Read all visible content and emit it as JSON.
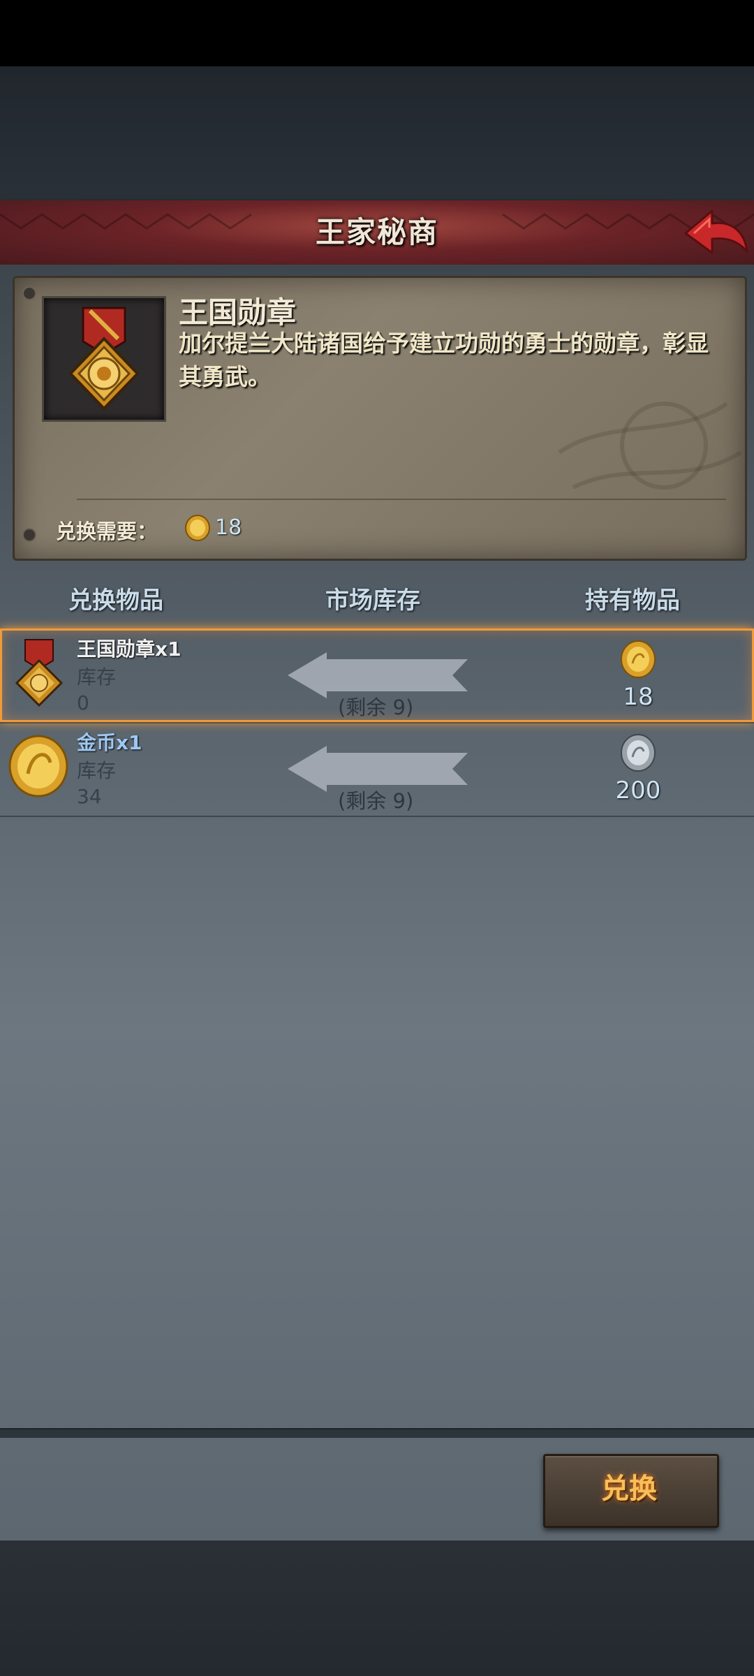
{
  "title": "王家秘商",
  "item": {
    "name": "王国勋章",
    "description": "加尔提兰大陆诸国给予建立功勋的勇士的勋章，彰显其勇武。",
    "cost_label": "兑换需要：",
    "cost_value": "18"
  },
  "columns": {
    "exchange_item": "兑换物品",
    "market_stock": "市场库存",
    "owned_item": "持有物品"
  },
  "rows": [
    {
      "name": "王国勋章",
      "qty": "x1",
      "stock_label": "库存",
      "stock_value": "0",
      "remaining": "(剩余 9)",
      "owned": "18",
      "selected": true
    },
    {
      "name": "金币",
      "qty": "x1",
      "stock_label": "库存",
      "stock_value": "34",
      "remaining": "(剩余 9)",
      "owned": "200",
      "selected": false
    }
  ],
  "exchange_button": "兑换",
  "colors": {
    "accent": "#f09a3a",
    "title_bar": "#6b2327",
    "button_text": "#f4c05a"
  }
}
